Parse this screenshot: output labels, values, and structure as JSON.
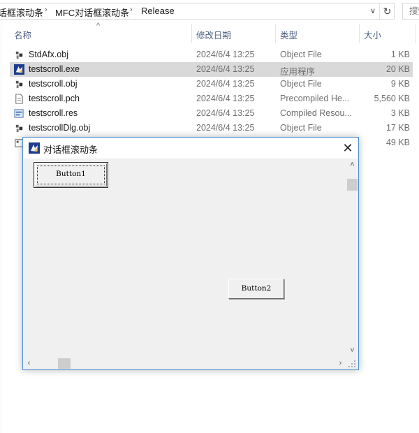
{
  "address_bar": {
    "crumbs": [
      "话框滚动条",
      "MFC对话框滚动条",
      "Release"
    ],
    "separator": "›",
    "dropdown_glyph": "∨",
    "refresh_glyph": "↻",
    "search_placeholder": "搜索"
  },
  "file_list": {
    "sort_indicator": "^",
    "columns": {
      "name": "名称",
      "date": "修改日期",
      "type": "类型",
      "size": "大小"
    },
    "rows": [
      {
        "icon": "obj-file-icon",
        "name": "StdAfx.obj",
        "date": "2024/6/4 13:25",
        "type": "Object File",
        "size": "1 KB",
        "selected": false
      },
      {
        "icon": "exe-app-icon",
        "name": "testscroll.exe",
        "date": "2024/6/4 13:25",
        "type": "应用程序",
        "size": "20 KB",
        "selected": true
      },
      {
        "icon": "obj-file-icon",
        "name": "testscroll.obj",
        "date": "2024/6/4 13:25",
        "type": "Object File",
        "size": "9 KB",
        "selected": false
      },
      {
        "icon": "pch-file-icon",
        "name": "testscroll.pch",
        "date": "2024/6/4 13:25",
        "type": "Precompiled He...",
        "size": "5,560 KB",
        "selected": false
      },
      {
        "icon": "res-file-icon",
        "name": "testscroll.res",
        "date": "2024/6/4 13:25",
        "type": "Compiled Resou...",
        "size": "3 KB",
        "selected": false
      },
      {
        "icon": "obj-file-icon",
        "name": "testscrollDlg.obj",
        "date": "2024/6/4 13:25",
        "type": "Object File",
        "size": "17 KB",
        "selected": false
      },
      {
        "icon": "file-icon",
        "name": "",
        "date": "",
        "type": "",
        "size": "49 KB",
        "selected": false
      }
    ]
  },
  "dialog": {
    "title": "对话框滚动条",
    "close_glyph": "✕",
    "button1_label": "Button1",
    "button2_label": "Button2",
    "scroll_up": "˄",
    "scroll_down": "˅",
    "scroll_left": "‹",
    "scroll_right": "›"
  },
  "colors": {
    "selection": "#d9d9d9",
    "dialog_border": "#4a8fd6",
    "column_header_text": "#4d6082",
    "dialog_background": "#f0f0f0"
  }
}
